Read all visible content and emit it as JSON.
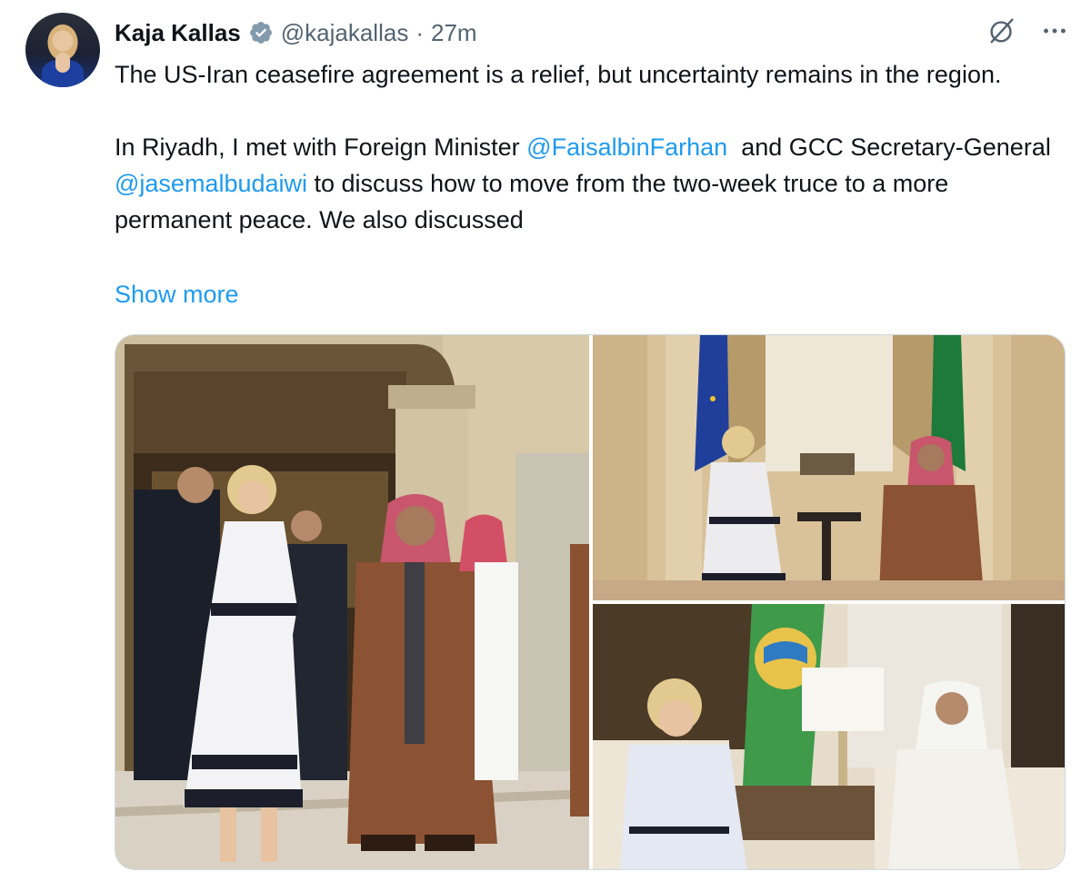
{
  "author": {
    "name": "Kaja Kallas",
    "handle": "@kajakallas",
    "separator": "·",
    "time": "27m"
  },
  "icons": {
    "verified": "verified-badge-icon",
    "grok": "grok-slash-icon",
    "more": "more-options-icon"
  },
  "tweet": {
    "line1": "The US-Iran ceasefire agreement is a relief, but uncertainty remains in the region.",
    "p2_part1": "In Riyadh, I met with Foreign Minister ",
    "mention1": "@FaisalbinFarhan",
    "p2_part2": "  and GCC Secretary-General ",
    "mention2": "@jasemalbudaiwi",
    "p2_part3": " to discuss how to move from the two-week truce to a more permanent peace. We also discussed",
    "show_more": "Show more"
  },
  "colors": {
    "link": "#1d9bf0",
    "secondary_text": "#536471",
    "verified": "#829aab"
  }
}
